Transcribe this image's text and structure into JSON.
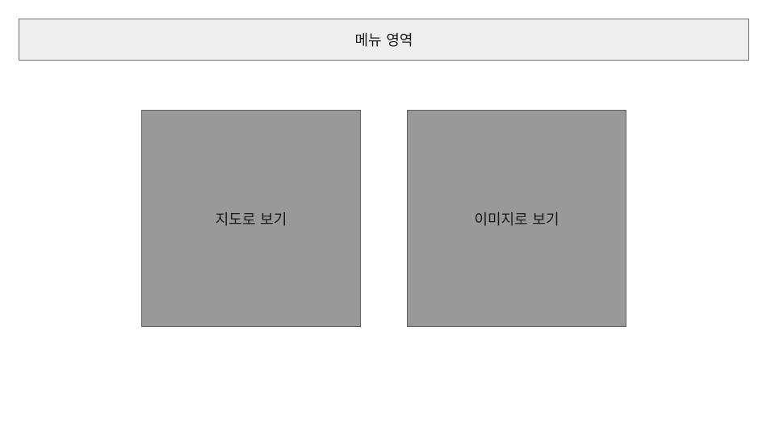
{
  "menu": {
    "label": "메뉴 영역"
  },
  "tiles": [
    {
      "label": "지도로 보기"
    },
    {
      "label": "이미지로 보기"
    }
  ],
  "colors": {
    "menu_background": "#eeeeee",
    "tile_background": "#999999",
    "page_background": "#ffffff"
  }
}
